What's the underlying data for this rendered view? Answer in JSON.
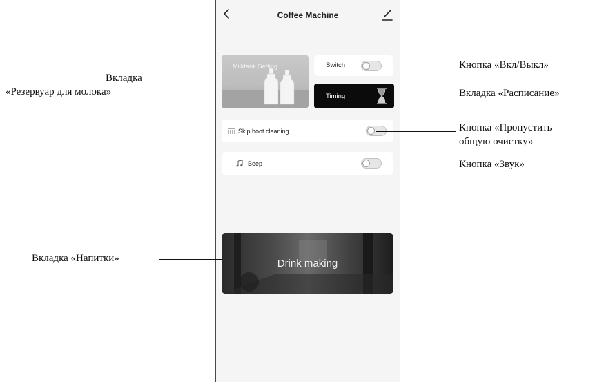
{
  "app": {
    "title": "Coffee Machine"
  },
  "tiles": {
    "milktank_label": "Milktank Setting",
    "switch_label": "Switch",
    "switch_on": false,
    "timing_label": "Timing",
    "drink_label": "Drink making"
  },
  "settings": {
    "skip_label": "Skip boot cleaning",
    "skip_on": false,
    "beep_label": "Beep",
    "beep_on": false
  },
  "annotations": {
    "milktank_line1": "Вкладка",
    "milktank_line2": "«Резервуар для молока»",
    "drinks": "Вкладка «Напитки»",
    "switch": "Кнопка «Вкл/Выкл»",
    "timing": "Вкладка «Расписание»",
    "skip_line1": "Кнопка «Пропустить",
    "skip_line2": "общую очистку»",
    "beep": "Кнопка «Звук»"
  },
  "icons": {
    "back": "chevron-left-icon",
    "edit": "edit-icon",
    "skip": "cleaning-icon",
    "beep": "music-note-icon",
    "timing": "hourglass-icon"
  }
}
